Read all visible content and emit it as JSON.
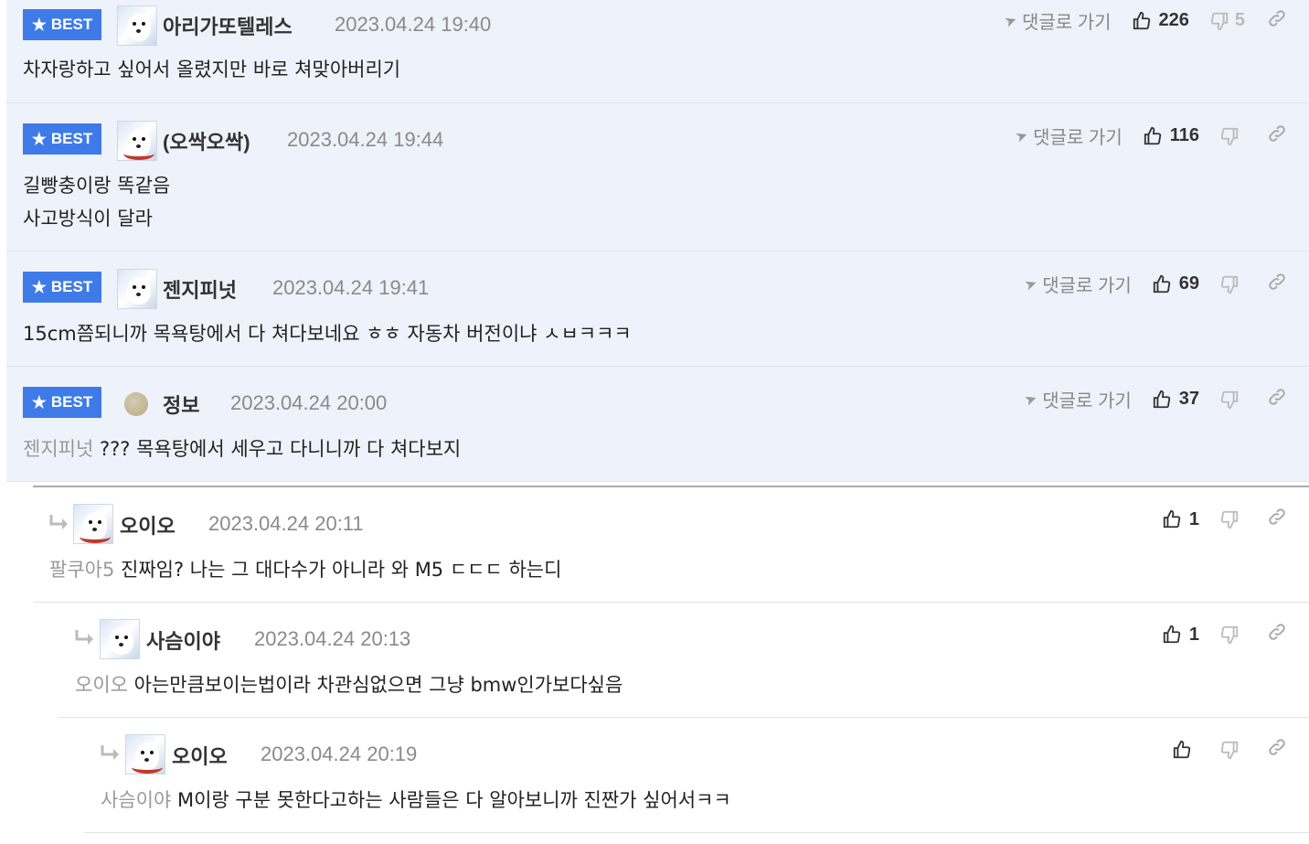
{
  "comments": [
    {
      "nick": "아리가또텔레스",
      "date": "2023.04.24 19:40",
      "mention": "",
      "body": "차자랑하고 싶어서 올렸지만 바로 쳐맞아버리기",
      "body2": "",
      "up": "226",
      "down": "5",
      "best": "BEST",
      "goto": "댓글로 가기"
    },
    {
      "nick": "(오싹오싹)",
      "date": "2023.04.24 19:44",
      "mention": "",
      "body": "길빵충이랑 똑같음",
      "body2": "사고방식이 달라",
      "up": "116",
      "down": "",
      "best": "BEST",
      "goto": "댓글로 가기"
    },
    {
      "nick": "젠지피넛",
      "date": "2023.04.24 19:41",
      "mention": "",
      "body": "15cm쯤되니까 목욕탕에서 다 쳐다보네요 ㅎㅎ 자동차 버전이냐 ㅅㅂㅋㅋㅋ",
      "body2": "",
      "up": "69",
      "down": "",
      "best": "BEST",
      "goto": "댓글로 가기"
    },
    {
      "nick": "정보",
      "date": "2023.04.24 20:00",
      "mention": "젠지피넛",
      "body": "??? 목욕탕에서 세우고 다니니까 다 쳐다보지",
      "body2": "",
      "up": "37",
      "down": "",
      "best": "BEST",
      "goto": "댓글로 가기"
    },
    {
      "nick": "오이오",
      "date": "2023.04.24 20:11",
      "mention": "팔쿠아5",
      "body": "진짜임? 나는 그 대다수가 아니라 와 M5 ㄷㄷㄷ 하는디",
      "body2": "",
      "up": "1",
      "down": ""
    },
    {
      "nick": "사슴이야",
      "date": "2023.04.24 20:13",
      "mention": "오이오",
      "body": "아는만큼보이는법이라 차관심없으면 그냥 bmw인가보다싶음",
      "body2": "",
      "up": "1",
      "down": ""
    },
    {
      "nick": "오이오",
      "date": "2023.04.24 20:19",
      "mention": "사슴이야",
      "body": "M이랑 구분 못한다고하는 사람들은 다 알아보니까 진짠가 싶어서ㅋㅋ",
      "body2": "",
      "up": "",
      "down": ""
    }
  ]
}
